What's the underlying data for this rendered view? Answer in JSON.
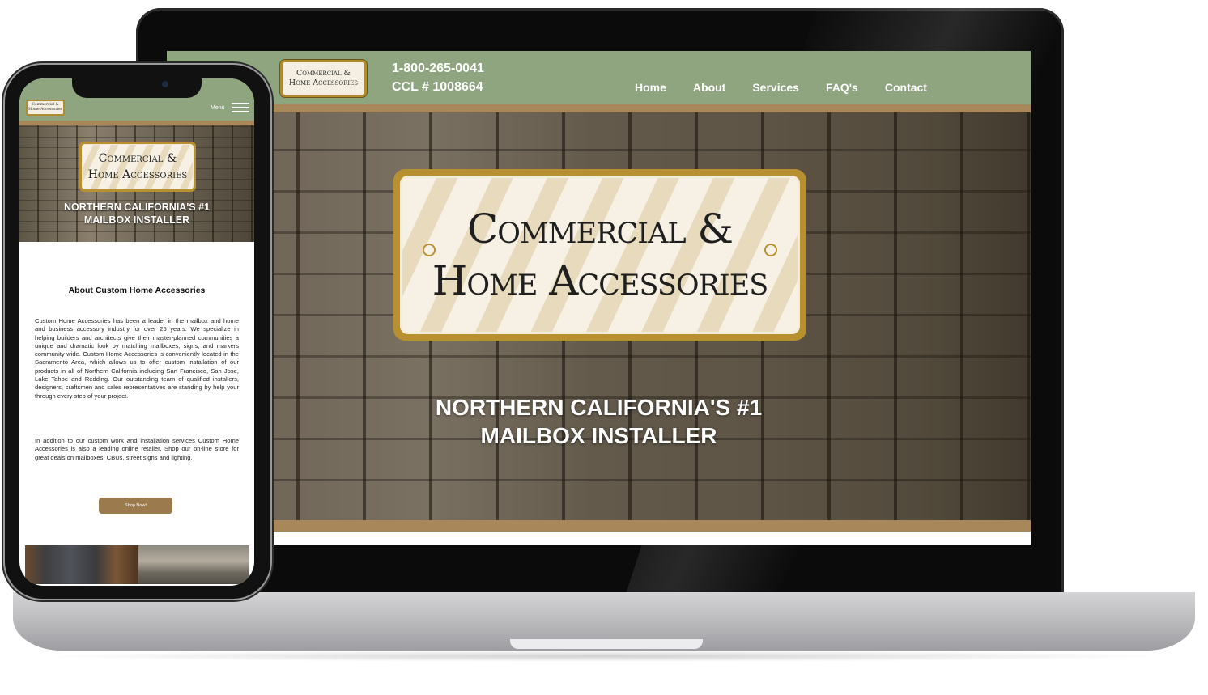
{
  "laptop_site": {
    "logo": {
      "line1": "Commercial &",
      "line2": "Home Accessories"
    },
    "phone": "1-800-265-0041",
    "ccl": "CCL # 1008664",
    "nav": [
      "Home",
      "About",
      "Services",
      "FAQ's",
      "Contact"
    ],
    "hero_logo": {
      "line1": "Commercial &",
      "line2": "Home Accessories"
    },
    "hero_title_line1": "NORTHERN CALIFORNIA'S #1",
    "hero_title_line2": "MAILBOX INSTALLER"
  },
  "mobile_site": {
    "logo": {
      "line1": "Commercial &",
      "line2": "Home Accessories"
    },
    "menu_label": "Menu",
    "hero_logo": {
      "line1": "Commercial &",
      "line2": "Home Accessories"
    },
    "hero_title_line1": "NORTHERN CALIFORNIA'S #1",
    "hero_title_line2": "MAILBOX INSTALLER",
    "about_title": "About Custom Home Accessories",
    "about_p1": "Custom Home Accessories has been a leader in the mailbox and home and business accessory industry for over 25 years. We specialize in helping builders and architects give their master-planned communities a unique and dramatic look by matching mailboxes, signs, and markers community wide. Custom Home Accessories is conveniently located in the Sacramento Area, which allows us to offer custom installation of our products in all of Northern California including San Francisco, San Jose, Lake Tahoe and Redding. Our outstanding team of qualified installers, designers, craftsmen and sales representatives are standing by help your through every step of your project.",
    "about_p2": "In addition to our custom work and installation services Custom Home Accessories is also a leading online retailer. Shop our on-line store for great deals on mailboxes, CBUs, street signs and lighting.",
    "shop_button": "Shop Now!"
  },
  "colors": {
    "header_green": "#8ea57f",
    "accent_tan": "#a8885a",
    "logo_gold": "#b8902f",
    "button_brown": "#9b7a4e"
  }
}
